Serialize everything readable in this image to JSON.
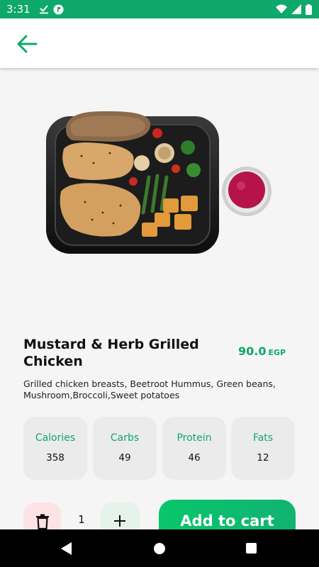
{
  "status_bar": {
    "time": "3:31"
  },
  "app_bar": {
    "back_icon": "arrow-left-icon"
  },
  "product": {
    "name": "Mustard & Herb Grilled Chicken",
    "price": "90.0",
    "currency": "EGP",
    "description": "Grilled chicken breasts, Beetroot Hummus, Green beans, Mushroom,Broccoli,Sweet potatoes"
  },
  "nutrition": [
    {
      "label": "Calories",
      "value": "358"
    },
    {
      "label": "Carbs",
      "value": "49"
    },
    {
      "label": "Protein",
      "value": "46"
    },
    {
      "label": "Fats",
      "value": "12"
    }
  ],
  "cart": {
    "quantity": "1",
    "add_label": "Add to cart"
  },
  "colors": {
    "accent": "#0ea86a",
    "delete_bg": "#fde3e6",
    "plus_bg": "#e5f3ea"
  }
}
